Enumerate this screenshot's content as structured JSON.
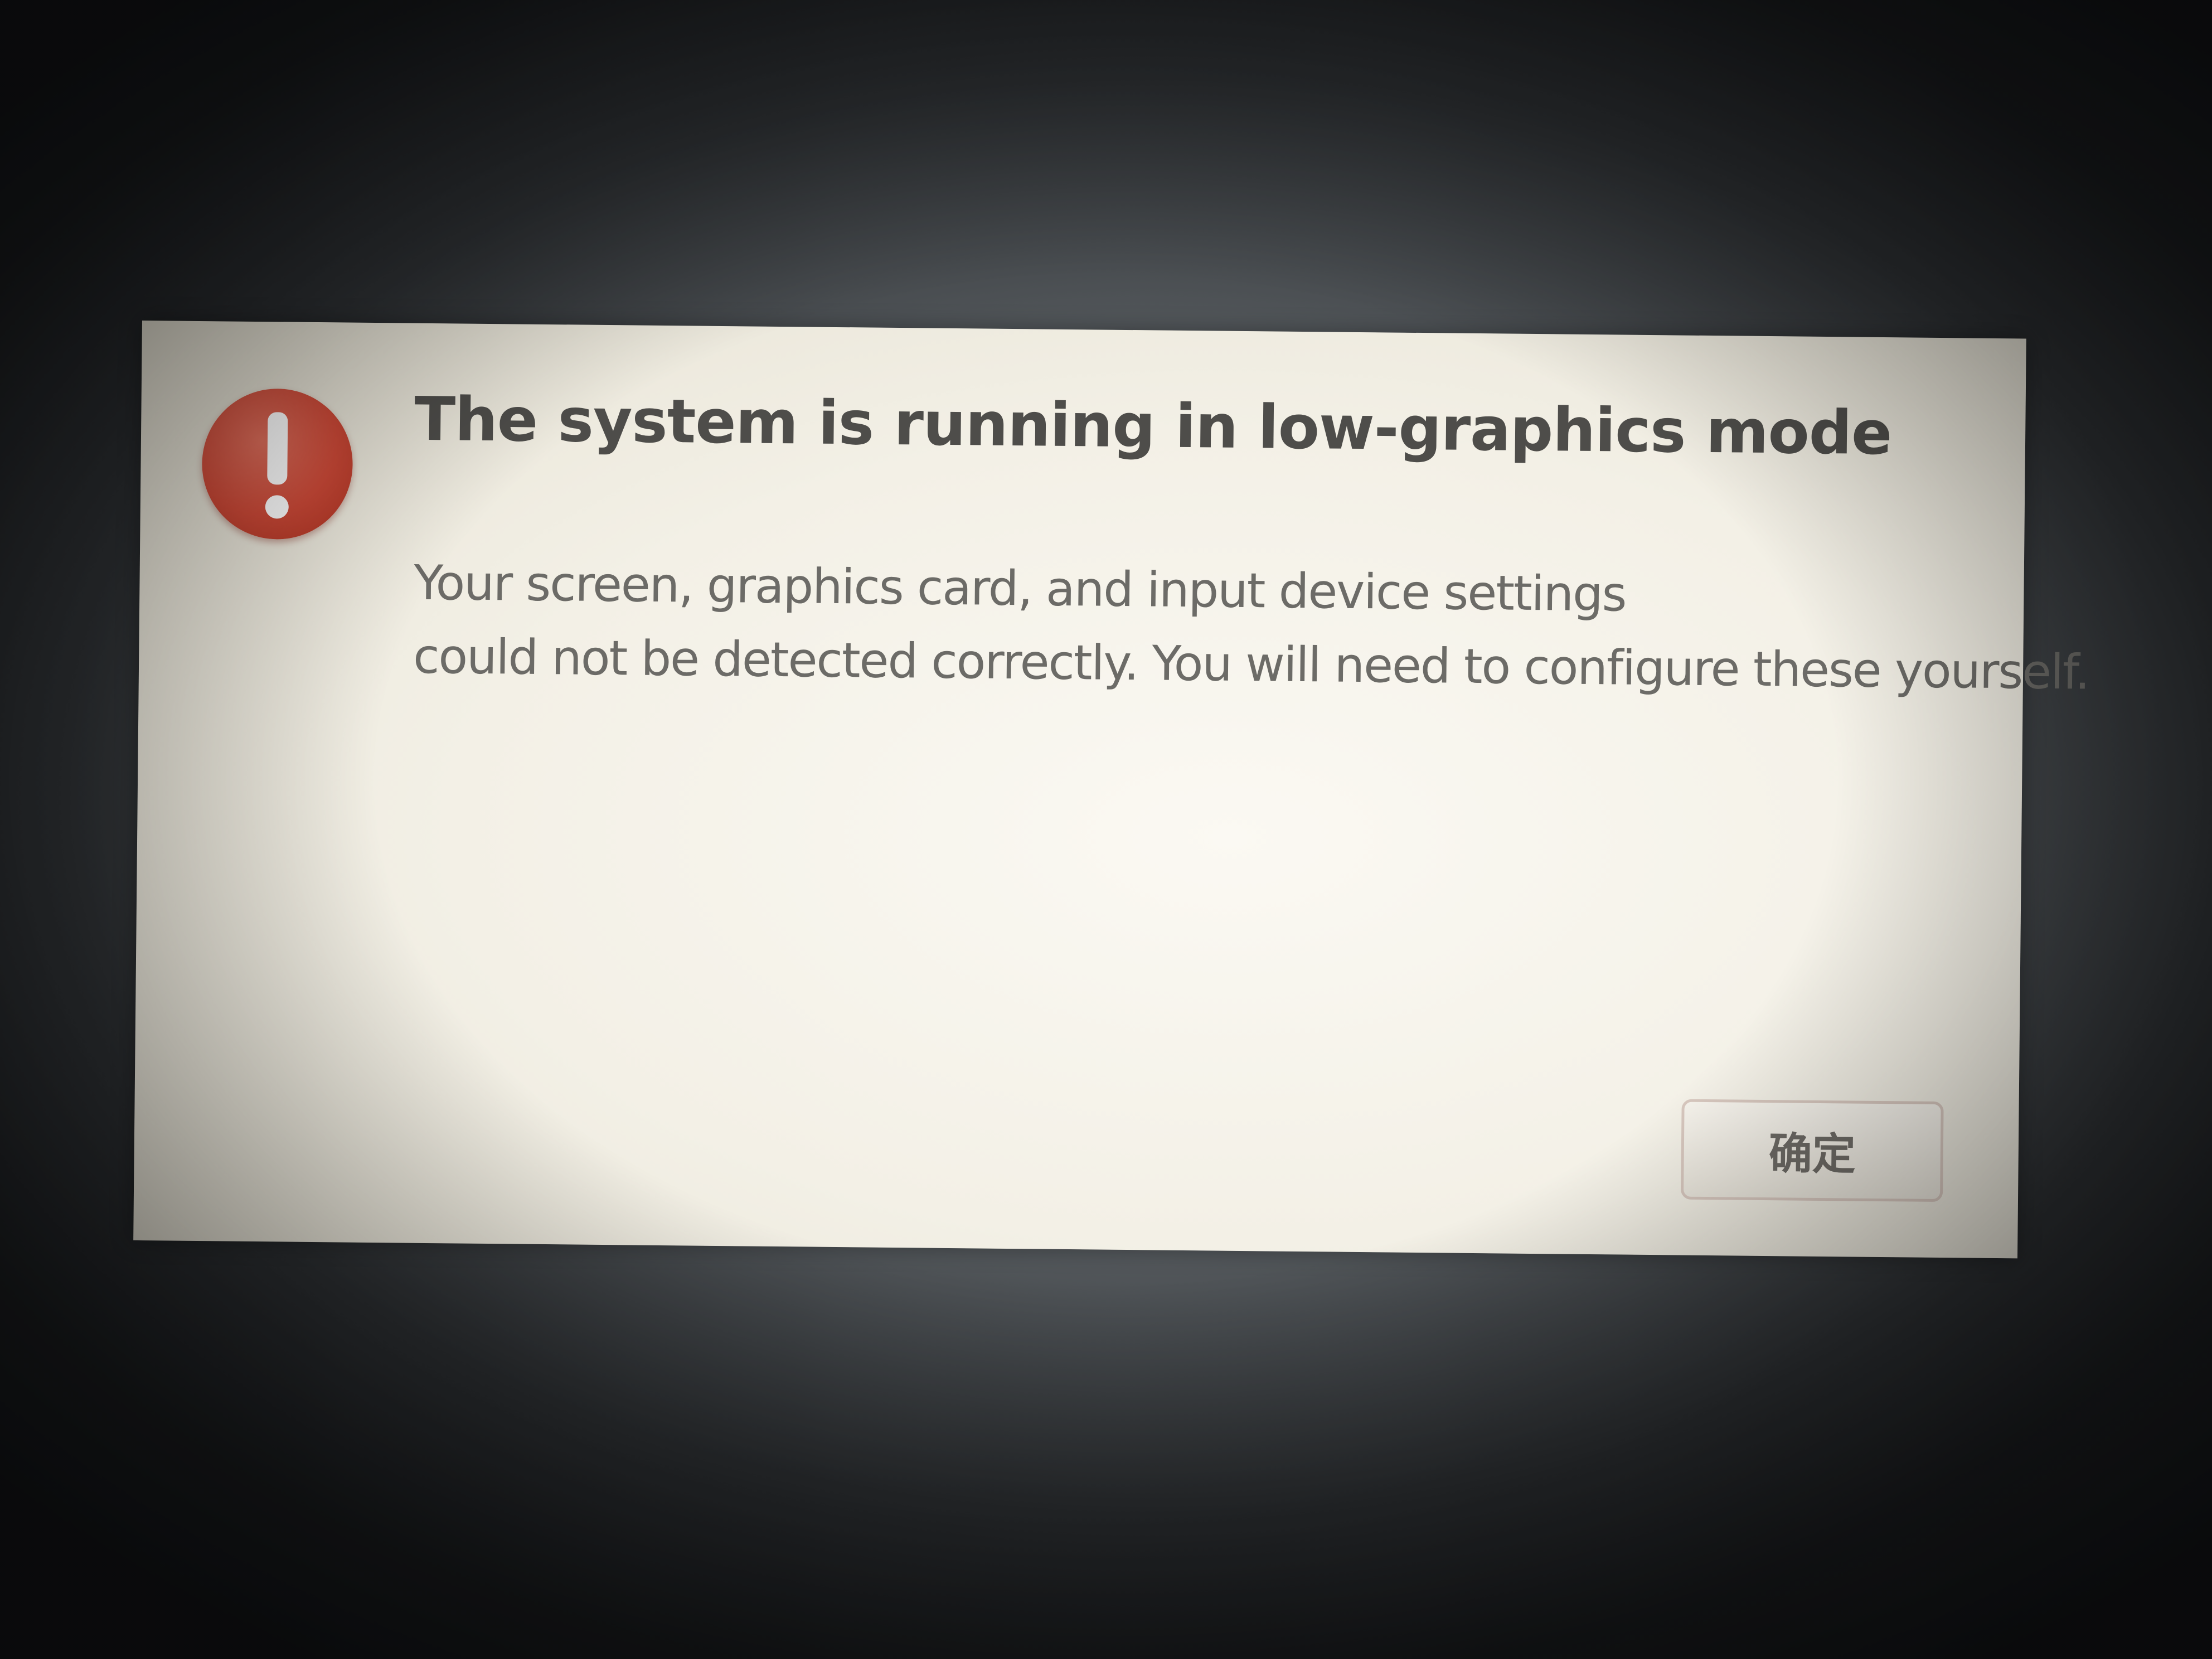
{
  "dialog": {
    "icon": "exclamation-icon",
    "title": "The system is running in low-graphics mode",
    "message_lines": [
      "Your screen, graphics card, and input device settings",
      "could not be detected correctly.  You will need to configure these yourself."
    ],
    "ok_label": "确定"
  },
  "colors": {
    "icon_red": "#cf4a38",
    "dialog_background": "#f3f0e6",
    "title_text": "#4e4d4a",
    "body_text": "#6c6b67"
  }
}
